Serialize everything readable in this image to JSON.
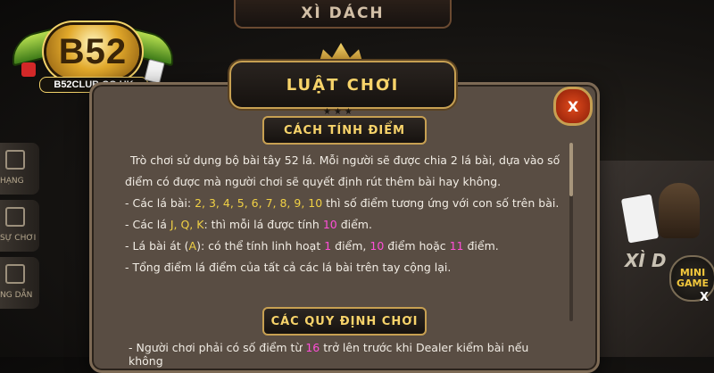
{
  "game_title": "XÌ DÁCH",
  "logo": {
    "brand": "B52",
    "url": "B52CLUB.CO.UK"
  },
  "side_menu": [
    {
      "label": "HẠNG",
      "icon": "trophy-icon"
    },
    {
      "label": "SỰ CHƠI",
      "icon": "document-icon"
    },
    {
      "label": "NG DẪN",
      "icon": "book-icon"
    }
  ],
  "modal": {
    "title": "LUẬT CHƠI",
    "close_label": "X",
    "stars": "★★★",
    "section1_title": "CÁCH TÍNH ĐIỂM",
    "intro": "Trò chơi sử dụng bộ bài tây 52 lá. Mỗi người sẽ được chia 2 lá bài, dựa vào số điểm có được mà người chơi sẽ quyết định rút thêm bài hay không.",
    "rule1_prefix": "- Các lá bài: ",
    "rule1_values": "2, 3, 4, 5, 6, 7, 8, 9, 10",
    "rule1_suffix": " thì số điểm tương ứng với con số trên bài.",
    "rule2_prefix": "- Các lá ",
    "rule2_values": "J, Q, K",
    "rule2_mid": ": thì mỗi lá được tính ",
    "rule2_points": "10",
    "rule2_suffix": " điểm.",
    "rule3_prefix": "- Lá bài át (",
    "rule3_card": "A",
    "rule3_mid1": "): có thể tính linh hoạt ",
    "rule3_p1": "1",
    "rule3_mid2": " điểm, ",
    "rule3_p2": "10",
    "rule3_mid3": " điểm hoặc ",
    "rule3_p3": "11",
    "rule3_suffix": " điểm.",
    "rule4": "- Tổng điểm lá điểm của tất cả các lá bài trên tay cộng lại.",
    "section2_title": "CÁC QUY ĐỊNH CHƠI",
    "rule5_prefix": "- Người chơi phải có số điểm từ ",
    "rule5_value": "16",
    "rule5_suffix": " trở lên trước khi Dealer kiểm bài nếu không"
  },
  "right_promo": {
    "game_text": "XÌ D",
    "badge": "MINI GAME",
    "badge_close": "X"
  },
  "colors": {
    "accent_gold": "#f7d36a",
    "number_yellow": "#f0d044",
    "number_pink": "#ff4fd8",
    "close_red": "#e04a1c"
  }
}
